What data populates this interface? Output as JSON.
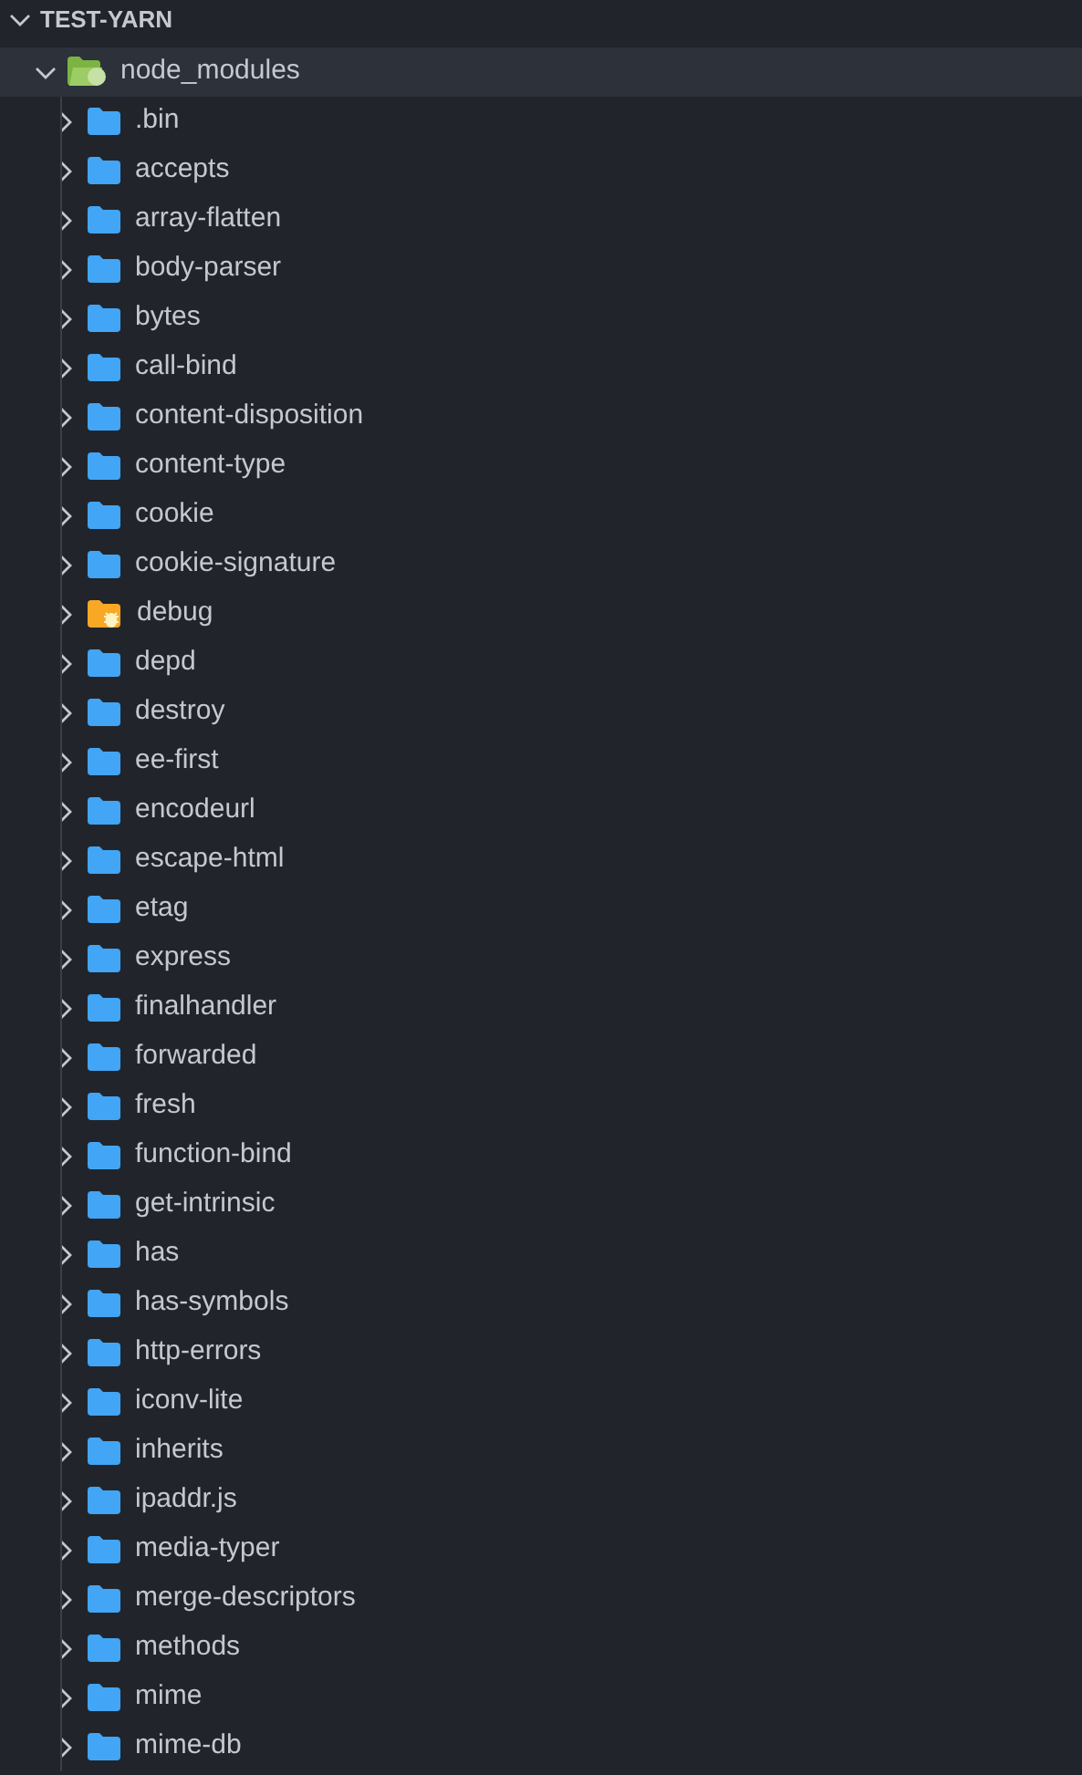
{
  "explorer": {
    "title": "TEST-YARN",
    "expanded": true,
    "root": {
      "name": "node_modules",
      "kind": "node",
      "expanded": true,
      "selected": true,
      "children": [
        {
          "name": ".bin",
          "kind": "folder",
          "expanded": false
        },
        {
          "name": "accepts",
          "kind": "folder",
          "expanded": false
        },
        {
          "name": "array-flatten",
          "kind": "folder",
          "expanded": false
        },
        {
          "name": "body-parser",
          "kind": "folder",
          "expanded": false
        },
        {
          "name": "bytes",
          "kind": "folder",
          "expanded": false
        },
        {
          "name": "call-bind",
          "kind": "folder",
          "expanded": false
        },
        {
          "name": "content-disposition",
          "kind": "folder",
          "expanded": false
        },
        {
          "name": "content-type",
          "kind": "folder",
          "expanded": false
        },
        {
          "name": "cookie",
          "kind": "folder",
          "expanded": false
        },
        {
          "name": "cookie-signature",
          "kind": "folder",
          "expanded": false
        },
        {
          "name": "debug",
          "kind": "bug",
          "expanded": false
        },
        {
          "name": "depd",
          "kind": "folder",
          "expanded": false
        },
        {
          "name": "destroy",
          "kind": "folder",
          "expanded": false
        },
        {
          "name": "ee-first",
          "kind": "folder",
          "expanded": false
        },
        {
          "name": "encodeurl",
          "kind": "folder",
          "expanded": false
        },
        {
          "name": "escape-html",
          "kind": "folder",
          "expanded": false
        },
        {
          "name": "etag",
          "kind": "folder",
          "expanded": false
        },
        {
          "name": "express",
          "kind": "folder",
          "expanded": false
        },
        {
          "name": "finalhandler",
          "kind": "folder",
          "expanded": false
        },
        {
          "name": "forwarded",
          "kind": "folder",
          "expanded": false
        },
        {
          "name": "fresh",
          "kind": "folder",
          "expanded": false
        },
        {
          "name": "function-bind",
          "kind": "folder",
          "expanded": false
        },
        {
          "name": "get-intrinsic",
          "kind": "folder",
          "expanded": false
        },
        {
          "name": "has",
          "kind": "folder",
          "expanded": false
        },
        {
          "name": "has-symbols",
          "kind": "folder",
          "expanded": false
        },
        {
          "name": "http-errors",
          "kind": "folder",
          "expanded": false
        },
        {
          "name": "iconv-lite",
          "kind": "folder",
          "expanded": false
        },
        {
          "name": "inherits",
          "kind": "folder",
          "expanded": false
        },
        {
          "name": "ipaddr.js",
          "kind": "folder",
          "expanded": false
        },
        {
          "name": "media-typer",
          "kind": "folder",
          "expanded": false
        },
        {
          "name": "merge-descriptors",
          "kind": "folder",
          "expanded": false
        },
        {
          "name": "methods",
          "kind": "folder",
          "expanded": false
        },
        {
          "name": "mime",
          "kind": "folder",
          "expanded": false
        },
        {
          "name": "mime-db",
          "kind": "folder",
          "expanded": false
        }
      ]
    }
  }
}
